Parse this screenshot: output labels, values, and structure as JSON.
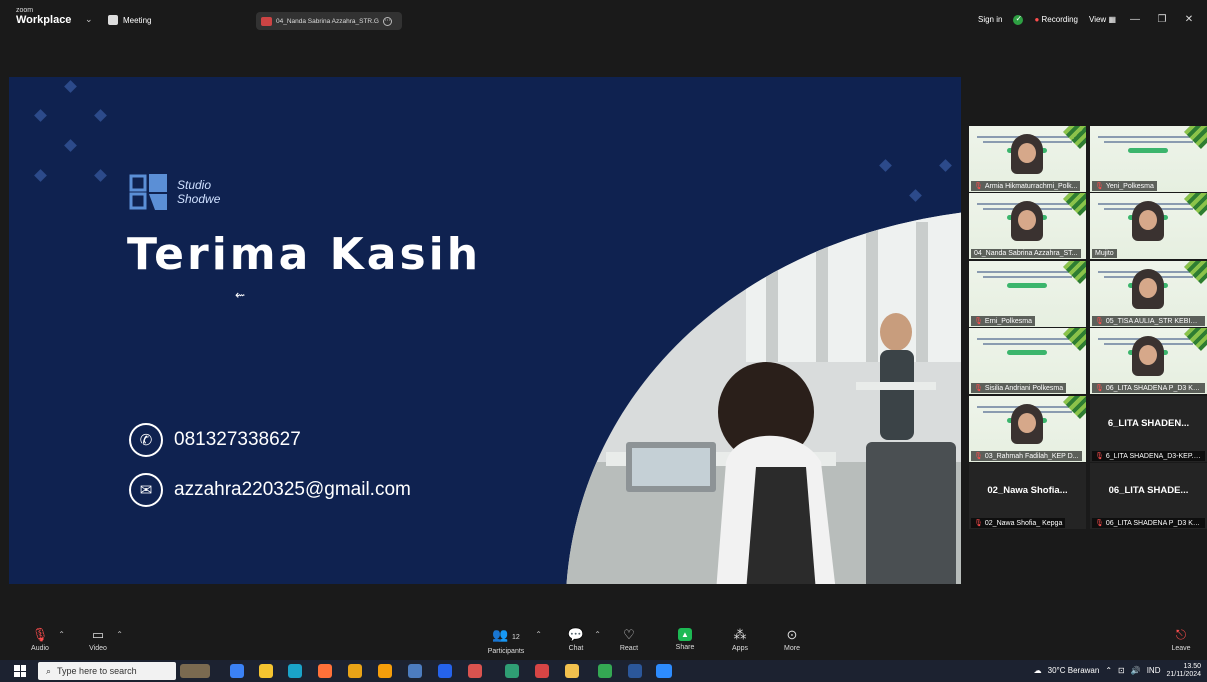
{
  "topbar": {
    "brand_small": "zoom",
    "brand_big": "Workplace",
    "meeting_label": "Meeting",
    "share_tab_label": "04_Nanda Sabrina Azzahra_STR.G",
    "sign_in": "Sign in",
    "recording": "Recording",
    "view": "View"
  },
  "slide": {
    "logo_line1": "Studio",
    "logo_line2": "Shodwe",
    "title": "Terima Kasih",
    "phone": "081327338627",
    "email": "azzahra220325@gmail.com"
  },
  "gallery": [
    {
      "name": "Armia Hikmaturrachmi_Polk...",
      "kind": "person",
      "muted": true
    },
    {
      "name": "Yeni_Polkesma",
      "kind": "screen",
      "muted": true
    },
    {
      "name": "04_Nanda Sabrina Azzahra_ST...",
      "kind": "person",
      "muted": false
    },
    {
      "name": "Mujito",
      "kind": "person",
      "muted": false
    },
    {
      "name": "Erni_Polkesma",
      "kind": "screen",
      "muted": true
    },
    {
      "name": "05_TISA AULIA_STR KEBIDA...",
      "kind": "person",
      "muted": true
    },
    {
      "name": "Sisilia Andriani Polkesma",
      "kind": "screen",
      "muted": true
    },
    {
      "name": "06_LITA SHADENA P_D3 KE...",
      "kind": "person",
      "muted": true
    },
    {
      "name": "03_Rahmah Fadilah_KEP D...",
      "kind": "person",
      "muted": true
    },
    {
      "name": "6_LITA SHADENA_D3-KEP.T...",
      "kind": "text",
      "big": "6_LITA SHADEN...",
      "muted": true
    },
    {
      "name": "02_Nawa Shofia_ Kepga",
      "kind": "text",
      "big": "02_Nawa Shofia...",
      "muted": true
    },
    {
      "name": "06_LITA SHADENA P_D3 KE...",
      "kind": "text",
      "big": "06_LITA SHADE...",
      "muted": true
    }
  ],
  "controls": {
    "audio": "Audio",
    "video": "Video",
    "participants": "Participants",
    "participants_count": "12",
    "chat": "Chat",
    "react": "React",
    "share": "Share",
    "apps": "Apps",
    "more": "More",
    "leave": "Leave"
  },
  "taskbar": {
    "search_placeholder": "Type here to search",
    "weather": "30°C Berawan",
    "lang": "IND",
    "time": "13.50",
    "date": "21/11/2024"
  },
  "colors": {
    "slide_bg": "#0f2250",
    "accent_green": "#1db954",
    "recording_red": "#ff4d4d"
  }
}
